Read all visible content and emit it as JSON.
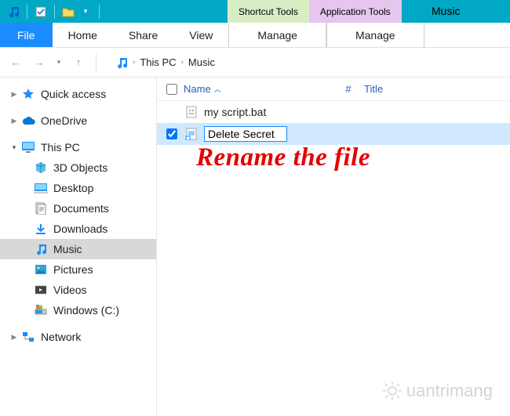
{
  "titlebar": {
    "shortcut_tools": "Shortcut Tools",
    "application_tools": "Application Tools",
    "title": "Music"
  },
  "ribbon": {
    "file": "File",
    "home": "Home",
    "share": "Share",
    "view": "View",
    "manage1": "Manage",
    "manage2": "Manage"
  },
  "breadcrumb": {
    "root": "This PC",
    "current": "Music"
  },
  "columns": {
    "name": "Name",
    "num": "#",
    "title": "Title"
  },
  "files": [
    {
      "name": "my script.bat",
      "selected": false,
      "editing": false
    },
    {
      "name": "Delete Secret",
      "selected": true,
      "editing": true
    }
  ],
  "sidebar": {
    "quick_access": "Quick access",
    "onedrive": "OneDrive",
    "this_pc": "This PC",
    "objects3d": "3D Objects",
    "desktop": "Desktop",
    "documents": "Documents",
    "downloads": "Downloads",
    "music": "Music",
    "pictures": "Pictures",
    "videos": "Videos",
    "windows_c": "Windows (C:)",
    "network": "Network"
  },
  "annotation": "Rename the file",
  "watermark": "uantrimang"
}
